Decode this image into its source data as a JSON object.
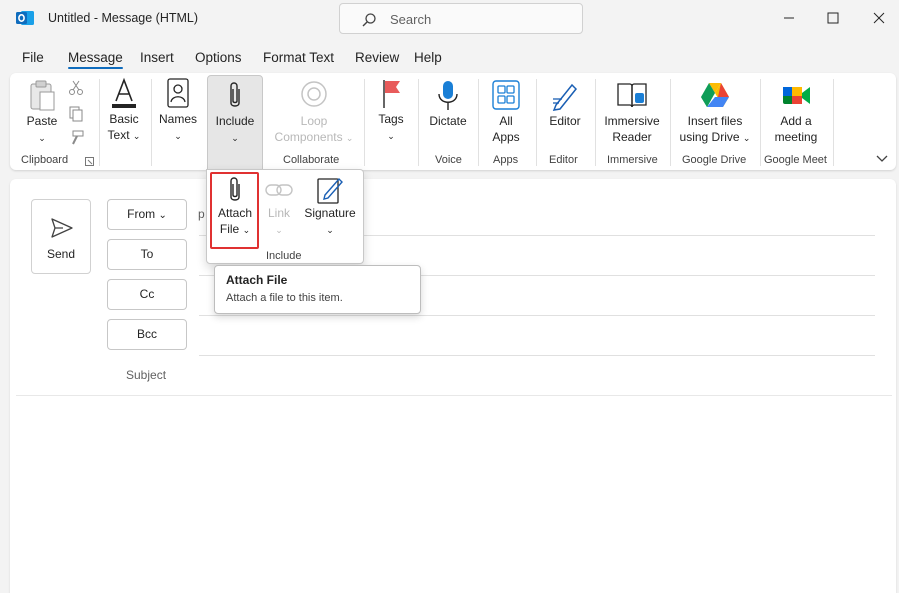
{
  "window": {
    "title": "Untitled  -  Message (HTML)",
    "search_placeholder": "Search"
  },
  "menu": [
    "File",
    "Message",
    "Insert",
    "Options",
    "Format Text",
    "Review",
    "Help"
  ],
  "ribbon": {
    "paste": "Paste",
    "basic_text": [
      "Basic",
      "Text"
    ],
    "names": "Names",
    "include": "Include",
    "loop": [
      "Loop",
      "Components"
    ],
    "tags": "Tags",
    "dictate": "Dictate",
    "all_apps": [
      "All",
      "Apps"
    ],
    "editor": "Editor",
    "immersive": [
      "Immersive",
      "Reader"
    ],
    "insert_drive": [
      "Insert files",
      "using Drive"
    ],
    "meeting": [
      "Add a",
      "meeting"
    ],
    "groups": {
      "clipboard": "Clipboard",
      "collaborate": "Collaborate",
      "voice": "Voice",
      "apps": "Apps",
      "editor": "Editor",
      "immersive": "Immersive",
      "google_drive": "Google Drive",
      "google_meet": "Google Meet"
    }
  },
  "include_popup": {
    "attach": [
      "Attach",
      "File"
    ],
    "link": "Link",
    "signature": "Signature",
    "group_label": "Include"
  },
  "tooltip": {
    "title": "Attach File",
    "description": "Attach a file to this item."
  },
  "compose": {
    "send": "Send",
    "from": "From",
    "from_value": "p",
    "to": "To",
    "cc": "Cc",
    "bcc": "Bcc",
    "subject": "Subject"
  },
  "colors": {
    "accent": "#0f6cbd",
    "highlight": "#e03131"
  }
}
